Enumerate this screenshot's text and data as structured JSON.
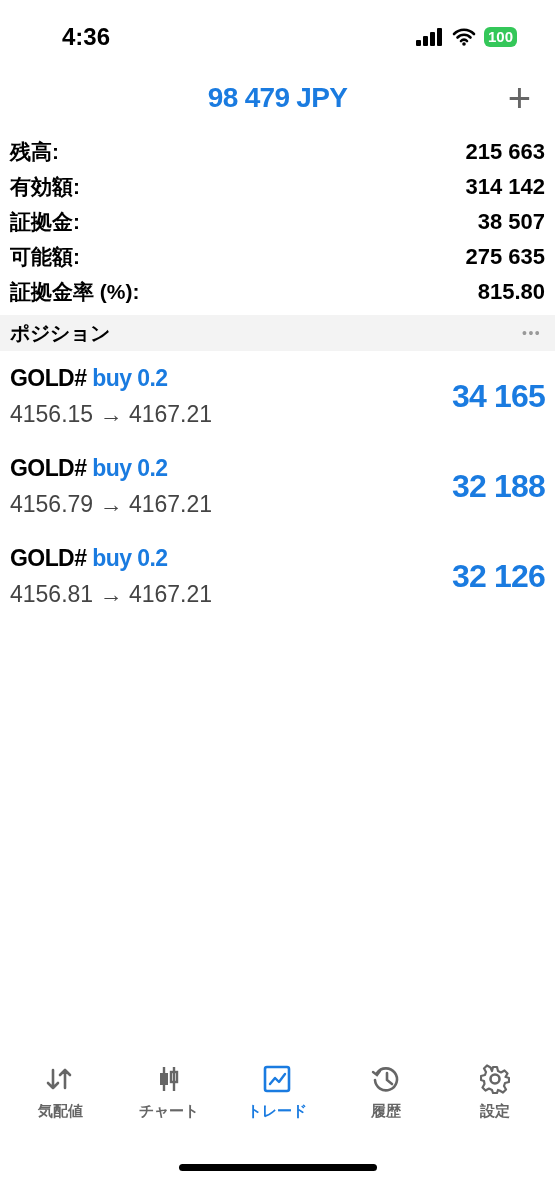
{
  "status_bar": {
    "time": "4:36",
    "battery": "100"
  },
  "header": {
    "title": "98 479 JPY",
    "add": "+"
  },
  "account": [
    {
      "label": "残高:",
      "value": "215 663"
    },
    {
      "label": "有効額:",
      "value": "314 142"
    },
    {
      "label": "証拠金:",
      "value": "38 507"
    },
    {
      "label": "可能額:",
      "value": "275 635"
    },
    {
      "label": "証拠金率 (%):",
      "value": "815.80"
    }
  ],
  "positions_header": {
    "title": "ポジション",
    "more": "•••"
  },
  "positions": [
    {
      "symbol": "GOLD#",
      "order": "buy 0.2",
      "prices": "4156.15 → 4167.21",
      "profit": "34 165"
    },
    {
      "symbol": "GOLD#",
      "order": "buy 0.2",
      "prices": "4156.79 → 4167.21",
      "profit": "32 188"
    },
    {
      "symbol": "GOLD#",
      "order": "buy 0.2",
      "prices": "4156.81 → 4167.21",
      "profit": "32 126"
    }
  ],
  "tabs": [
    {
      "kind": "quotes",
      "label": "気配値",
      "selected": false
    },
    {
      "kind": "chart",
      "label": "チャート",
      "selected": false
    },
    {
      "kind": "trade",
      "label": "トレード",
      "selected": true
    },
    {
      "kind": "history",
      "label": "履歴",
      "selected": false
    },
    {
      "kind": "settings",
      "label": "設定",
      "selected": false
    }
  ]
}
